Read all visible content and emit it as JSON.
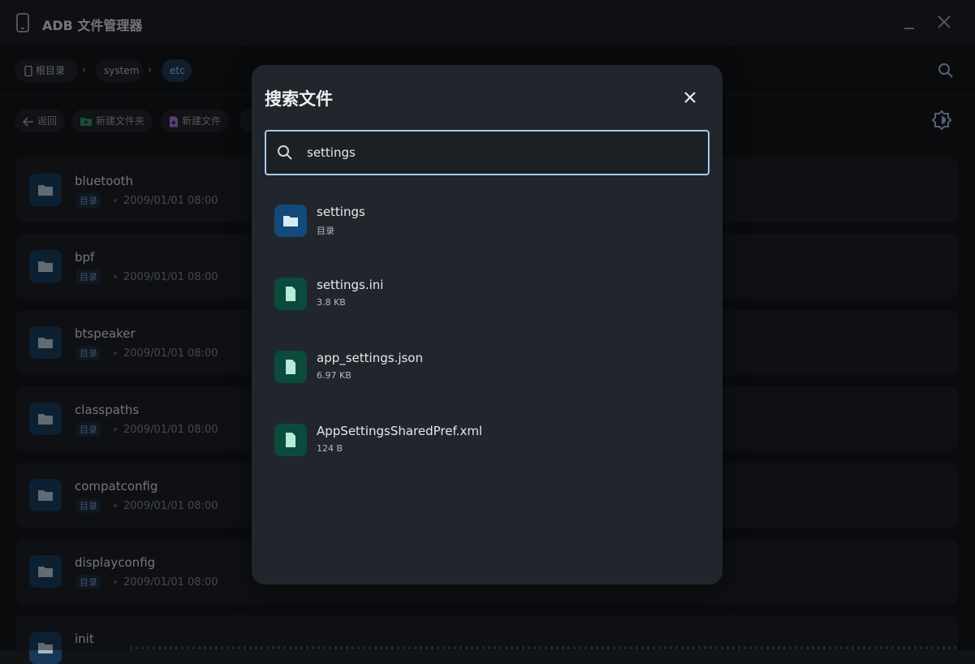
{
  "window": {
    "title": "ADB 文件管理器"
  },
  "breadcrumb": {
    "root": "根目录",
    "system": "system",
    "current": "etc"
  },
  "toolbar": {
    "back": "返回",
    "new_folder": "新建文件夹",
    "new_file": "新建文件"
  },
  "files": [
    {
      "name": "bluetooth",
      "tag": "目录",
      "date": "2009/01/01 08:00"
    },
    {
      "name": "bpf",
      "tag": "目录",
      "date": "2009/01/01 08:00"
    },
    {
      "name": "btspeaker",
      "tag": "目录",
      "date": "2009/01/01 08:00"
    },
    {
      "name": "classpaths",
      "tag": "目录",
      "date": "2009/01/01 08:00"
    },
    {
      "name": "compatconfig",
      "tag": "目录",
      "date": "2009/01/01 08:00"
    },
    {
      "name": "displayconfig",
      "tag": "目录",
      "date": "2009/01/01 08:00"
    },
    {
      "name": "init",
      "tag": "",
      "date": ""
    }
  ],
  "search_dialog": {
    "title": "搜索文件",
    "query": "settings",
    "results": [
      {
        "name": "settings",
        "meta": "目录",
        "type": "folder"
      },
      {
        "name": "settings.ini",
        "meta": "3.8 KB",
        "type": "file"
      },
      {
        "name": "app_settings.json",
        "meta": "6.97 KB",
        "type": "file"
      },
      {
        "name": "AppSettingsSharedPref.xml",
        "meta": "124 B",
        "type": "file"
      }
    ]
  },
  "colors": {
    "accent": "#a8c7ea",
    "folder_icon_bg": "#134a7a",
    "file_icon_bg": "#0d4a3e"
  }
}
